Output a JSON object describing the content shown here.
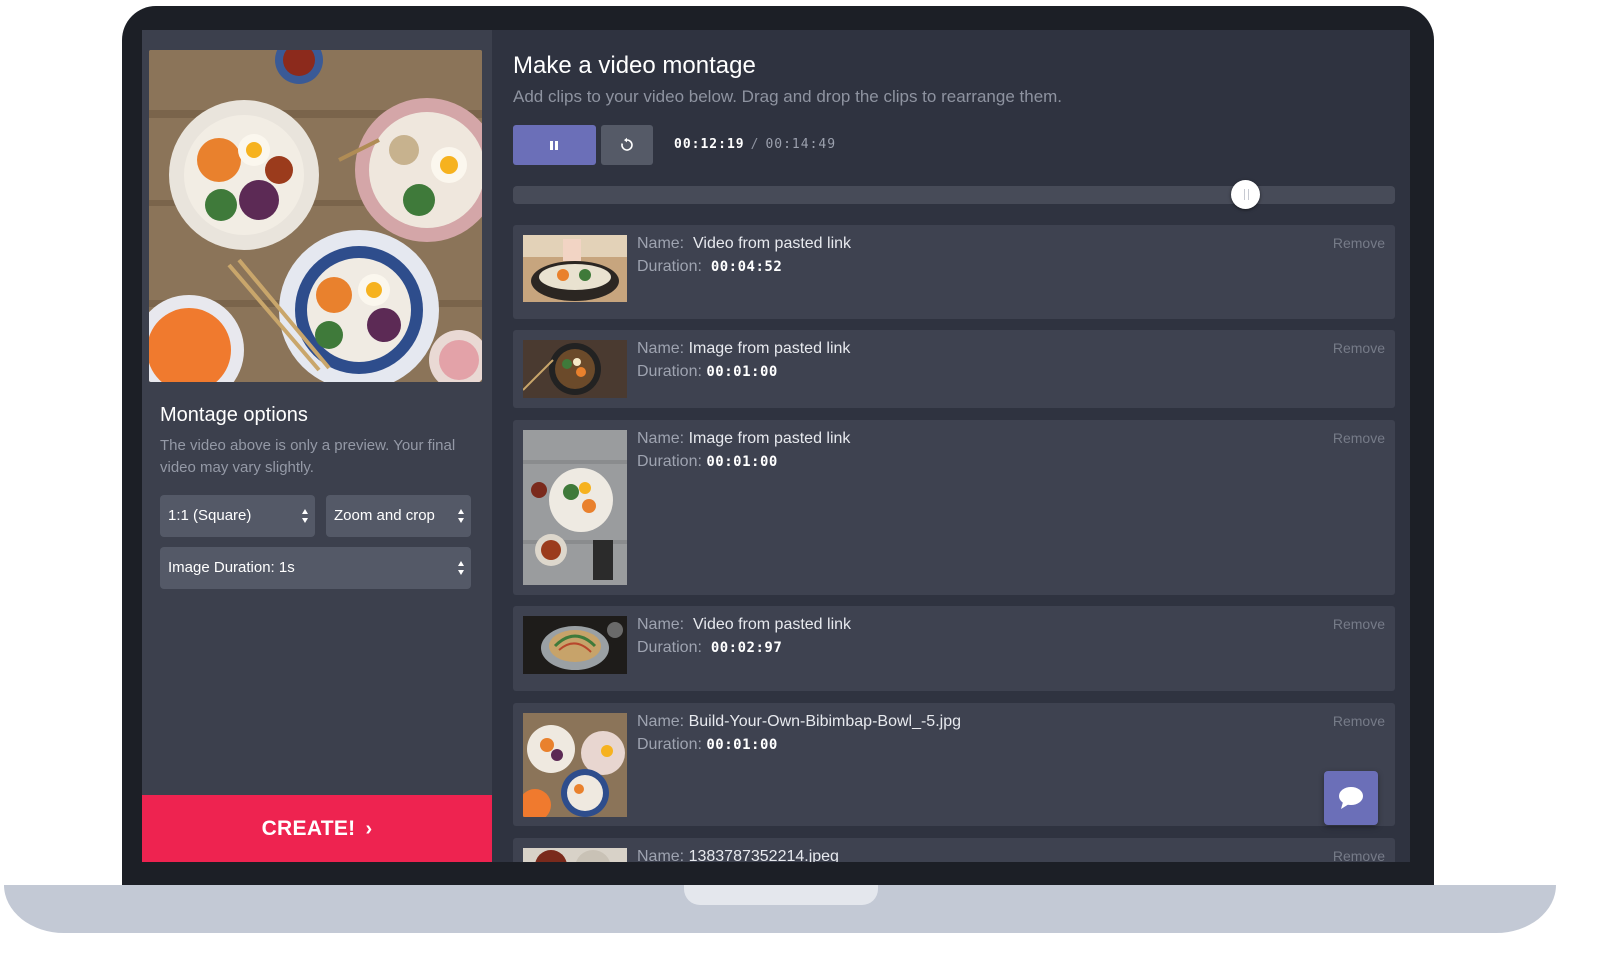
{
  "left_panel": {
    "options_title": "Montage options",
    "options_description": "The video above is only a preview. Your final video may vary slightly.",
    "aspect_select": "1:1 (Square)",
    "fit_select": "Zoom and crop",
    "duration_select": "Image Duration: 1s",
    "create_label": "CREATE!"
  },
  "header": {
    "title": "Make a video montage",
    "subtitle": "Add clips to your video below. Drag and drop the clips to rearrange them."
  },
  "player": {
    "current_time": "00:12:19",
    "separator": "/",
    "total_time": "00:14:49",
    "progress_fraction": 0.83
  },
  "clips": [
    {
      "name_label": "Name:",
      "name": "Video from pasted link",
      "duration_label": "Duration:",
      "duration": "00:04:52",
      "remove_label": "Remove"
    },
    {
      "name_label": "Name:",
      "name": "Image from pasted link",
      "duration_label": "Duration:",
      "duration": "00:01:00",
      "remove_label": "Remove"
    },
    {
      "name_label": "Name:",
      "name": "Image from pasted link",
      "duration_label": "Duration:",
      "duration": "00:01:00",
      "remove_label": "Remove"
    },
    {
      "name_label": "Name:",
      "name": "Video from pasted link",
      "duration_label": "Duration:",
      "duration": "00:02:97",
      "remove_label": "Remove"
    },
    {
      "name_label": "Name:",
      "name": "Build-Your-Own-Bibimbap-Bowl_-5.jpg",
      "duration_label": "Duration:",
      "duration": "00:01:00",
      "remove_label": "Remove"
    },
    {
      "name_label": "Name:",
      "name": "1383787352214.jpeg",
      "remove_label": "Remove"
    }
  ],
  "colors": {
    "accent": "#6b6fb8",
    "create": "#ee2350",
    "panel": "#3c404d",
    "background": "#2f3340"
  },
  "icons": [
    "pause-icon",
    "restart-icon",
    "chevron-right-icon",
    "select-arrows-icon",
    "chat-icon"
  ]
}
